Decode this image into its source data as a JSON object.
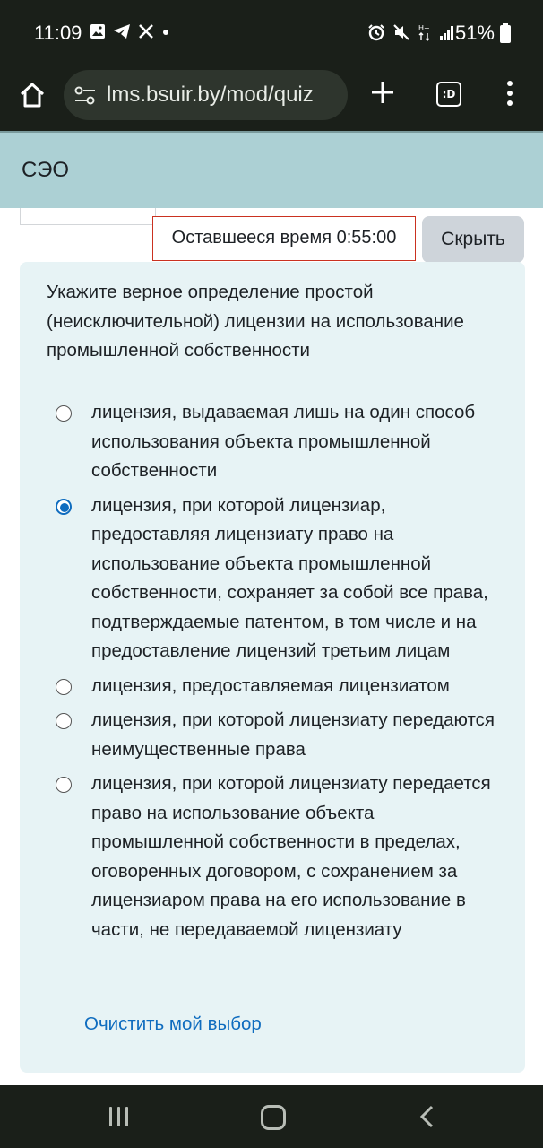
{
  "status_bar": {
    "time": "11:09",
    "battery": "51%",
    "left_icons": [
      "gallery-icon",
      "telegram-icon",
      "x-icon",
      "dot-icon"
    ],
    "right_icons": [
      "alarm-icon",
      "mute-icon",
      "data-h-plus-icon",
      "signal-icon",
      "battery-icon"
    ]
  },
  "browser": {
    "url": "lms.bsuir.by/mod/quiz",
    "tabs_label": ":D",
    "icons": [
      "home-icon",
      "tune-icon",
      "plus-icon",
      "tabs-icon",
      "more-vert-icon"
    ]
  },
  "site": {
    "title": "СЭО"
  },
  "quiz": {
    "timer": "Оставшееся время 0:55:00",
    "hide_label": "Скрыть",
    "question": "Укажите верное определение простой (неисключительной) лицензии на использование промышленной собственности",
    "answers": [
      {
        "label": "лицензия, выдаваемая лишь на один способ использования объекта промышленной собственности",
        "selected": false
      },
      {
        "label": "лицензия, при которой лицензиар, предоставляя лицензиату право на использование объекта промышленной собственности, сохраняет за собой все права, подтверждаемые патентом, в том числе и на предоставление лицензий третьим лицам",
        "selected": true
      },
      {
        "label": "лицензия, предоставляемая лицензиатом",
        "selected": false
      },
      {
        "label": "лицензия, при которой лицензиату передаются неимущественные права",
        "selected": false
      },
      {
        "label": "лицензия, при которой лицензиату передается право на использование объекта промышленной собственности в пределах, оговоренных договором, с сохранением за лицензиаром права на его использование в части, не передаваемой лицензиату",
        "selected": false
      }
    ],
    "clear_label": "Очистить мой выбор"
  },
  "colors": {
    "header_bg": "#acd0d4",
    "question_bg": "#e7f3f5",
    "accent": "#0f6cbf",
    "timer_border": "#ca3120"
  }
}
